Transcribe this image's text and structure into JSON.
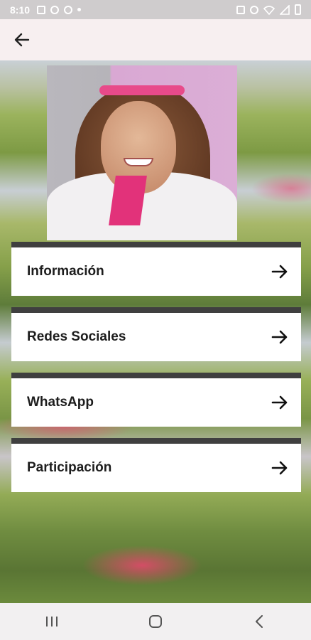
{
  "status_bar": {
    "time": "8:10",
    "left_icons": [
      "gallery-icon",
      "instagram-icon",
      "facebook-icon",
      "dot-icon"
    ],
    "right_icons": [
      "vibrate-icon",
      "mute-icon",
      "wifi-icon",
      "signal-icon",
      "battery-icon"
    ]
  },
  "app_bar": {
    "back_icon": "arrow-left-icon",
    "background": "#f7eff0"
  },
  "profile": {
    "photo": "profile-photo"
  },
  "menu": {
    "items": [
      {
        "label": "Información",
        "icon": "arrow-right-icon"
      },
      {
        "label": "Redes Sociales",
        "icon": "arrow-right-icon"
      },
      {
        "label": "WhatsApp",
        "icon": "arrow-right-icon"
      },
      {
        "label": "Participación",
        "icon": "arrow-right-icon"
      }
    ],
    "bar_color": "#3f3f3f",
    "text_color": "#1d1d1d"
  },
  "nav_bar": {
    "buttons": [
      "recent-apps-icon",
      "home-icon",
      "back-icon"
    ]
  }
}
